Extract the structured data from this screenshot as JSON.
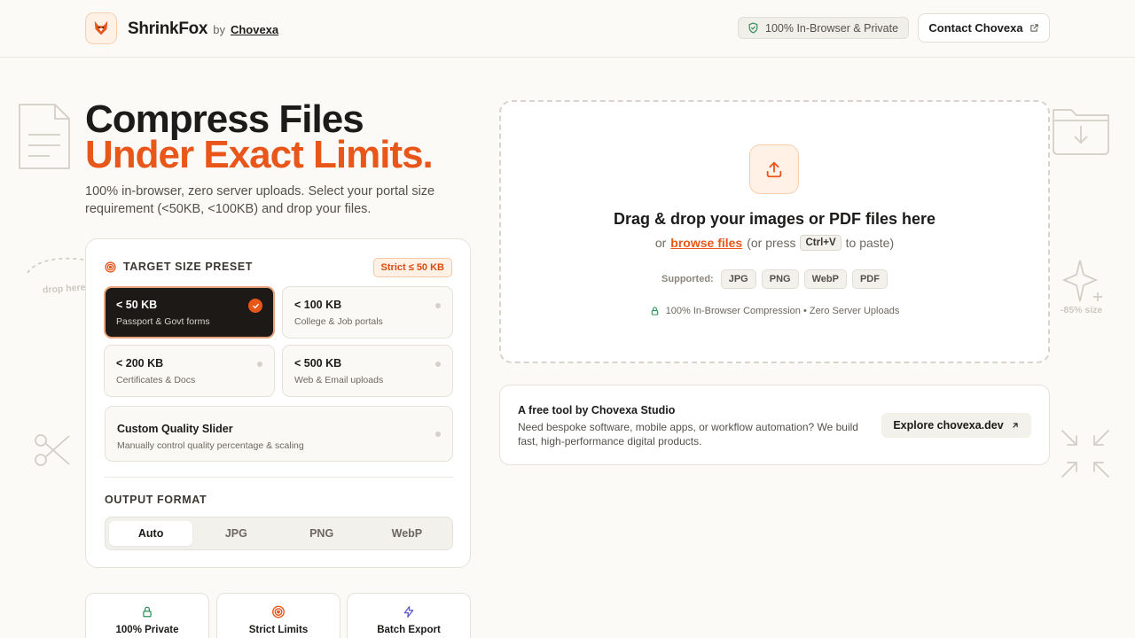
{
  "header": {
    "brand_name": "ShrinkFox",
    "brand_by": "by",
    "brand_org": "Chovexa",
    "privacy_badge": "100% In-Browser & Private",
    "contact_label": "Contact Chovexa"
  },
  "hero": {
    "title_line1": "Compress Files",
    "title_line2": "Under Exact Limits.",
    "subtitle": "100% in-browser, zero server uploads. Select your portal size requirement (<50KB, <100KB) and drop your files."
  },
  "settings": {
    "preset_title": "TARGET SIZE PRESET",
    "strict_badge": "Strict ≤ 50 KB",
    "presets": [
      {
        "title": "< 50 KB",
        "sub": "Passport & Govt forms",
        "active": true
      },
      {
        "title": "< 100 KB",
        "sub": "College & Job portals",
        "active": false
      },
      {
        "title": "< 200 KB",
        "sub": "Certificates & Docs",
        "active": false
      },
      {
        "title": "< 500 KB",
        "sub": "Web & Email uploads",
        "active": false
      }
    ],
    "slider": {
      "title": "Custom Quality Slider",
      "sub": "Manually control quality percentage & scaling"
    },
    "format_title": "OUTPUT FORMAT",
    "formats": [
      "Auto",
      "JPG",
      "PNG",
      "WebP"
    ],
    "selected_format": "Auto"
  },
  "features": [
    {
      "label": "100% Private",
      "icon": "lock-icon",
      "color": "#2f8f5b"
    },
    {
      "label": "Strict Limits",
      "icon": "target-icon",
      "color": "#e8561a"
    },
    {
      "label": "Batch Export",
      "icon": "lightning-icon",
      "color": "#5b55d6"
    }
  ],
  "dropzone": {
    "title": "Drag & drop your images or PDF files here",
    "or": "or",
    "browse": "browse files",
    "or_press": "(or press",
    "shortcut": "Ctrl+V",
    "to_paste": "to paste)",
    "supported_label": "Supported:",
    "formats": [
      "JPG",
      "PNG",
      "WebP",
      "PDF"
    ],
    "note": "100% In-Browser Compression • Zero Server Uploads"
  },
  "promo": {
    "title": "A free tool by Chovexa Studio",
    "text": "Need bespoke software, mobile apps, or workflow automation? We build fast, high-performance digital products.",
    "button": "Explore chovexa.dev"
  },
  "decorations": {
    "drop_here": "drop here",
    "size_reduction": "-85% size"
  },
  "colors": {
    "accent": "#e8561a",
    "dark": "#1c1917",
    "background": "#fbfaf7"
  }
}
